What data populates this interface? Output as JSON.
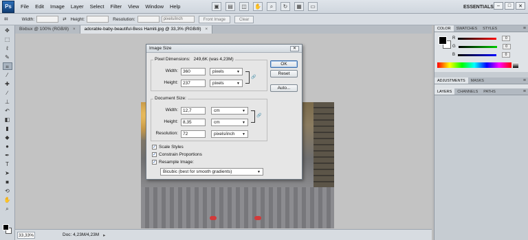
{
  "app": {
    "logo": "Ps",
    "workspace": "ESSENTIALS ▾"
  },
  "menu": [
    "File",
    "Edit",
    "Image",
    "Layer",
    "Select",
    "Filter",
    "View",
    "Window",
    "Help"
  ],
  "window_controls": [
    "–",
    "□",
    "✕"
  ],
  "options_bar": {
    "width_label": "Width:",
    "height_label": "Height:",
    "resolution_label": "Resolution:",
    "resolution_unit": "pixels/inch",
    "front_image_label": "Front Image",
    "clear_label": "Clear"
  },
  "tabs": [
    {
      "label": "Bixbux @ 100% (RGB/8)",
      "close": "×"
    },
    {
      "label": "adorable-baby-beautiful-Bess Hamiti.jpg @ 33,3% (RGB/8)",
      "close": "×"
    }
  ],
  "status": {
    "zoom": "33,33%",
    "doc": "Doc: 4,23M/4,23M",
    "arrow": "▸"
  },
  "panels": {
    "color_tabs": [
      "COLOR",
      "SWATCHES",
      "STYLES"
    ],
    "color_rows": [
      {
        "channel": "R",
        "value": "0"
      },
      {
        "channel": "G",
        "value": "0"
      },
      {
        "channel": "B",
        "value": "0"
      }
    ],
    "adjust_tabs": [
      "ADJUSTMENTS",
      "MASKS"
    ],
    "layers_tabs": [
      "LAYERS",
      "CHANNELS",
      "PATHS"
    ],
    "panel_menu": "≡"
  },
  "dialog": {
    "title": "Image Size",
    "close": "✕",
    "pixel_dimensions_label": "Pixel Dimensions:",
    "pixel_dimensions_value": "249,6K (was 4,23M)",
    "pixel_width_label": "Width:",
    "pixel_width_value": "360",
    "pixel_width_unit": "pixels",
    "pixel_height_label": "Height:",
    "pixel_height_value": "237",
    "pixel_height_unit": "pixels",
    "document_size_label": "Document Size:",
    "doc_width_label": "Width:",
    "doc_width_value": "12,7",
    "doc_width_unit": "cm",
    "doc_height_label": "Height:",
    "doc_height_value": "8,35",
    "doc_height_unit": "cm",
    "resolution_label": "Resolution:",
    "resolution_value": "72",
    "resolution_unit": "pixels/inch",
    "scale_styles": "Scale Styles",
    "constrain_proportions": "Constrain Proportions",
    "resample_image": "Resample Image:",
    "resample_method": "Bicubic (best for smooth gradients)",
    "ok": "OK",
    "reset": "Reset",
    "auto": "Auto..."
  }
}
